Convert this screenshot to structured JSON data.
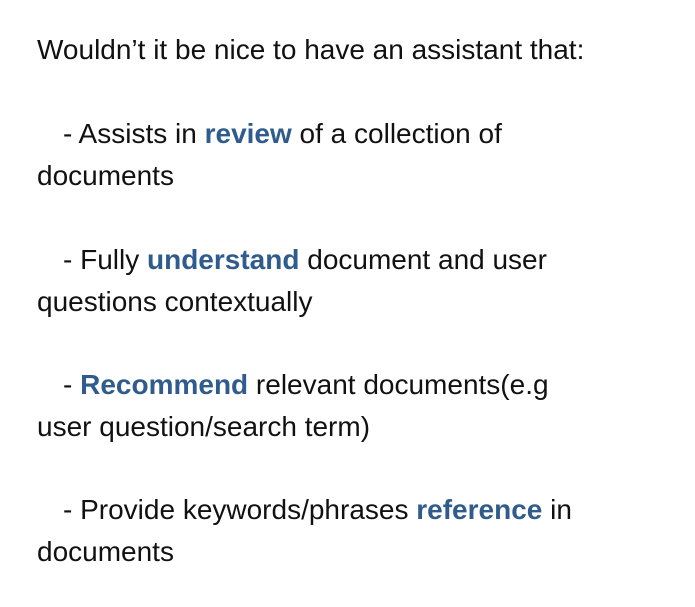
{
  "intro": "Wouldn’t it be nice to have an assistant that:",
  "bullets": [
    {
      "pre": "- Assists in ",
      "keyword": "review",
      "post": " of a collection of",
      "line2": "documents"
    },
    {
      "pre": "- Fully ",
      "keyword": "understand",
      "post": " document and user",
      "line2": "questions contextually"
    },
    {
      "pre": "- ",
      "keyword": "Recommend",
      "post": " relevant documents(e.g",
      "line2": "user question/search term)"
    },
    {
      "pre": "- Provide keywords/phrases ",
      "keyword": "reference",
      "post": " in",
      "line2": "documents"
    }
  ],
  "colors": {
    "text": "#111111",
    "keyword": "#2f5c8c",
    "background": "#ffffff"
  }
}
